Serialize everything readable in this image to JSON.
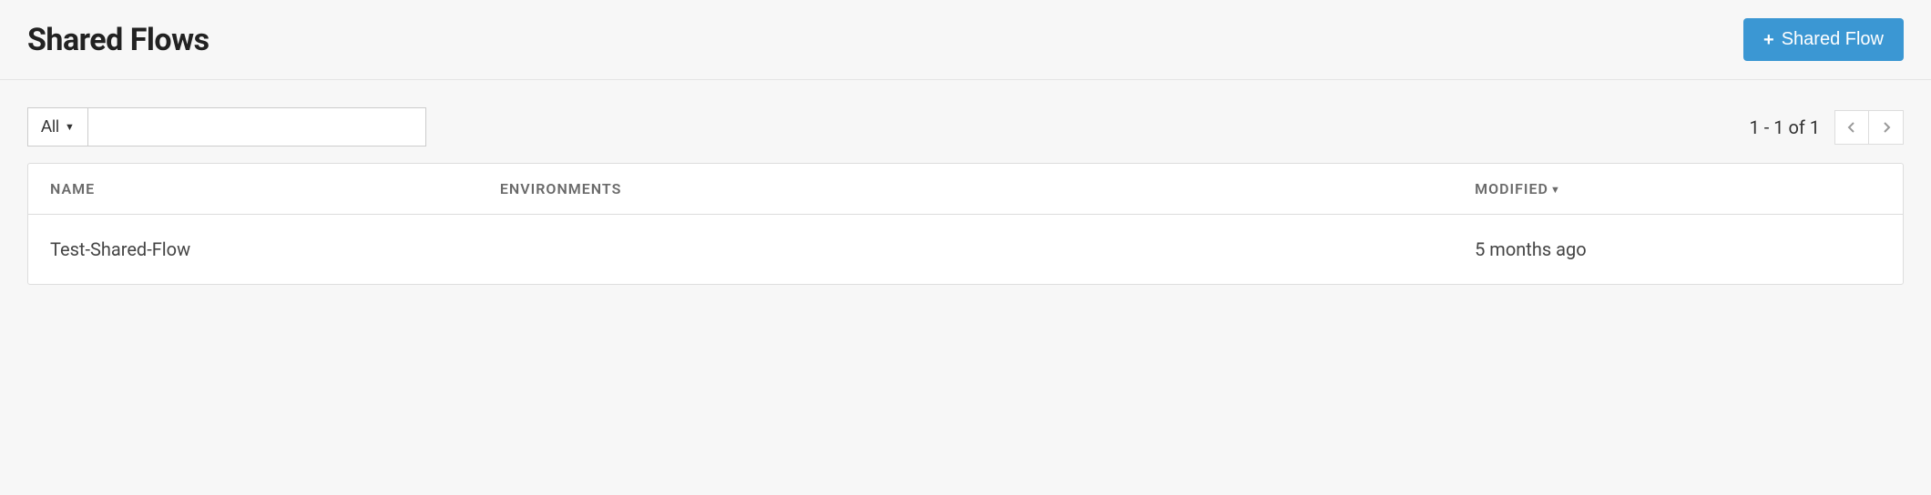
{
  "header": {
    "title": "Shared Flows",
    "create_button_label": "Shared Flow"
  },
  "toolbar": {
    "filter_selected": "All",
    "search_value": "",
    "search_placeholder": ""
  },
  "pagination": {
    "status": "1 - 1 of 1"
  },
  "table": {
    "columns": {
      "name": "NAME",
      "environments": "ENVIRONMENTS",
      "modified": "MODIFIED",
      "sort_indicator": "▼"
    },
    "rows": [
      {
        "name": "Test-Shared-Flow",
        "environments": "",
        "modified": "5 months ago"
      }
    ]
  }
}
